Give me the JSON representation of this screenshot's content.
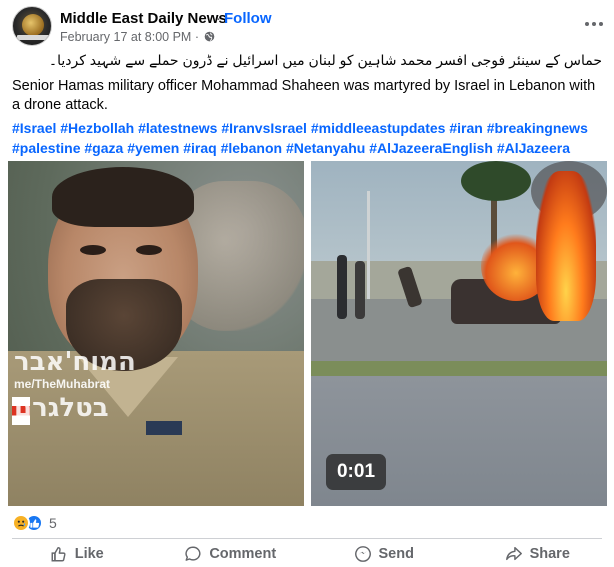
{
  "header": {
    "page_name": "Middle East Daily News",
    "separator": "·",
    "follow_label": "Follow",
    "timestamp": "February 17 at 8:00 PM",
    "meta_separator": "·"
  },
  "post": {
    "urdu_text": "حماس کے سینئر فوجی افسر محمد شاہین کو لبنان میں اسرائیل نے ڈرون حملے سے شہید کردیا۔",
    "english_text": "Senior Hamas military officer Mohammad Shaheen was martyred by Israel in Lebanon with a drone attack.",
    "hashtags_line1": [
      "#Israel",
      "#Hezbollah",
      "#latestnews",
      "#IranvsIsrael",
      "#middleeastupdates",
      "#iran",
      "#breakingnews"
    ],
    "hashtags_line2": [
      "#palestine",
      "#gaza",
      "#yemen",
      "#iraq",
      "#lebanon",
      "#Netanyahu",
      "#AlJazeeraEnglish",
      "#AlJazeera"
    ]
  },
  "media": {
    "left_watermark_top": "המוח'אבר",
    "left_watermark_handle": "me/TheMuhabrat",
    "left_watermark_bottom": "בטלגרם",
    "video_timer": "0:01"
  },
  "reactions": {
    "count": "5",
    "types": [
      "sad",
      "like"
    ]
  },
  "actions": {
    "like": "Like",
    "comment": "Comment",
    "send": "Send",
    "share": "Share"
  },
  "colors": {
    "link_blue": "#0866ff",
    "muted_gray": "#65676b",
    "text": "#050505"
  },
  "icons": {
    "audience": "globe-icon",
    "more": "more-options-icon",
    "like": "thumbs-up-icon",
    "comment": "comment-bubble-icon",
    "send": "send-icon",
    "share": "share-arrow-icon"
  }
}
